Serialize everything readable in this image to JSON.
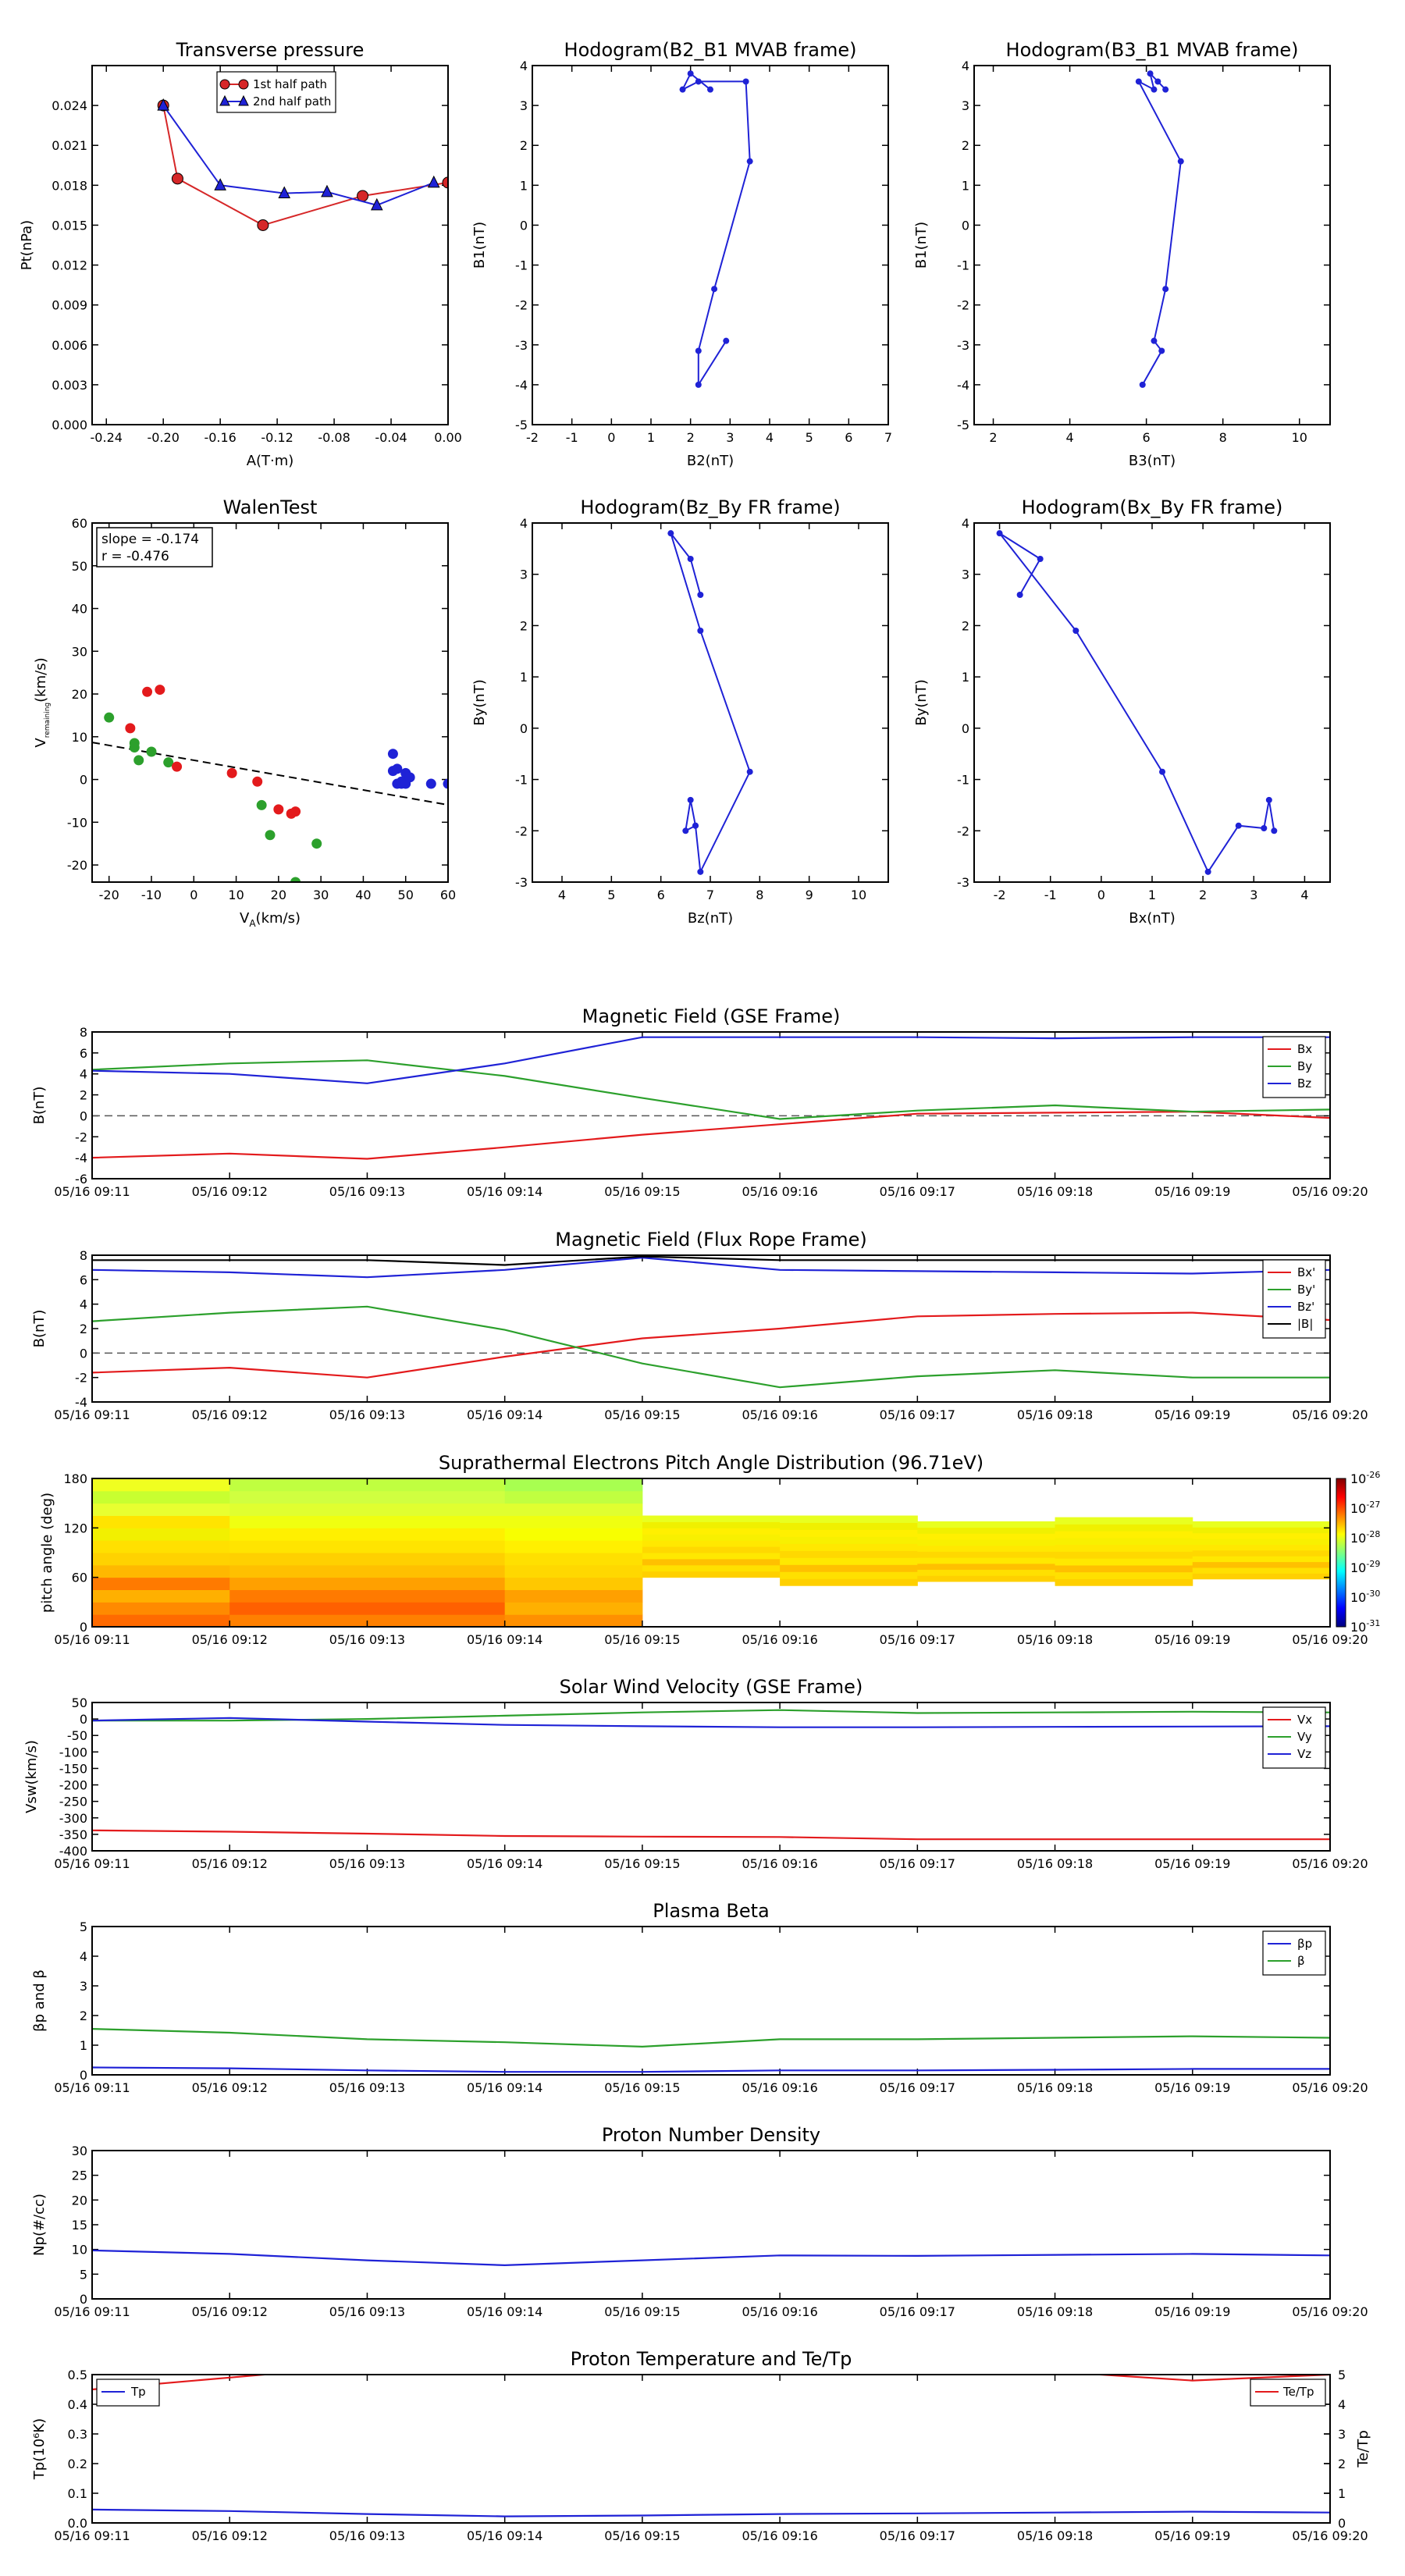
{
  "chart_data": [
    {
      "id": "transverse",
      "type": "line",
      "title": "Transverse pressure",
      "xlabel": "A(T·m)",
      "ylabel": "Pt(nPa)",
      "xlim": [
        -0.25,
        0.0
      ],
      "ylim": [
        0.0,
        0.027
      ],
      "xticks": [
        "-0.24",
        "-0.20",
        "-0.16",
        "-0.12",
        "-0.08",
        "-0.04",
        "0.00"
      ],
      "yticks": [
        "0.000",
        "0.003",
        "0.006",
        "0.009",
        "0.012",
        "0.015",
        "0.018",
        "0.021",
        "0.024"
      ],
      "series": [
        {
          "name": "1st half path",
          "color": "#d62728",
          "marker": "circle",
          "x": [
            -0.2,
            -0.19,
            -0.13,
            -0.06,
            0.0
          ],
          "y": [
            0.024,
            0.0185,
            0.015,
            0.0172,
            0.0182
          ]
        },
        {
          "name": "2nd half path",
          "color": "#1f22d6",
          "marker": "triangle",
          "x": [
            -0.2,
            -0.16,
            -0.115,
            -0.085,
            -0.05,
            -0.01
          ],
          "y": [
            0.024,
            0.018,
            0.0174,
            0.0175,
            0.0165,
            0.0182
          ]
        }
      ]
    },
    {
      "id": "hodo1",
      "type": "line",
      "title": "Hodogram(B2_B1 MVAB frame)",
      "xlabel": "B2(nT)",
      "ylabel": "B1(nT)",
      "xlim": [
        -2,
        7
      ],
      "ylim": [
        -5,
        4
      ],
      "xticks": [
        "-2",
        "-1",
        "0",
        "1",
        "2",
        "3",
        "4",
        "5",
        "6",
        "7"
      ],
      "yticks": [
        "-5",
        "-4",
        "-3",
        "-2",
        "-1",
        "0",
        "1",
        "2",
        "3",
        "4"
      ],
      "series": [
        {
          "color": "#1f22d6",
          "x": [
            2.5,
            2.0,
            1.8,
            2.2,
            3.4,
            3.5,
            2.6,
            2.2,
            2.2,
            2.9
          ],
          "y": [
            3.4,
            3.8,
            3.4,
            3.6,
            3.6,
            1.6,
            -1.6,
            -3.15,
            -4.0,
            -2.9
          ]
        }
      ]
    },
    {
      "id": "hodo2",
      "type": "line",
      "title": "Hodogram(B3_B1 MVAB frame)",
      "xlabel": "B3(nT)",
      "ylabel": "B1(nT)",
      "xlim": [
        1.5,
        10.8
      ],
      "ylim": [
        -5,
        4
      ],
      "xticks": [
        "2",
        "4",
        "6",
        "8",
        "10"
      ],
      "yticks": [
        "-5",
        "-4",
        "-3",
        "-2",
        "-1",
        "0",
        "1",
        "2",
        "3",
        "4"
      ],
      "series": [
        {
          "color": "#1f22d6",
          "x": [
            6.5,
            6.3,
            6.1,
            6.2,
            5.8,
            6.9,
            6.5,
            6.2,
            6.4,
            5.9
          ],
          "y": [
            3.4,
            3.6,
            3.8,
            3.4,
            3.6,
            1.6,
            -1.6,
            -2.9,
            -3.15,
            -4.0
          ]
        }
      ]
    },
    {
      "id": "walen",
      "type": "scatter",
      "title": "WalenTest",
      "xlabel": "V",
      "xlabel_sub": "A",
      "xlabel_rest": "(km/s)",
      "ylabel": "V",
      "ylabel_sub": "remaining",
      "ylabel_rest": "(km/s)",
      "xlim": [
        -24,
        60
      ],
      "ylim": [
        -24,
        60
      ],
      "xticks": [
        "-20",
        "-10",
        "0",
        "10",
        "20",
        "30",
        "40",
        "50",
        "60"
      ],
      "yticks": [
        "-20",
        "-10",
        "0",
        "10",
        "20",
        "30",
        "40",
        "50",
        "60"
      ],
      "annotation_slope": "slope = -0.174",
      "annotation_r": "r = -0.476",
      "fit": {
        "slope": -0.174,
        "intercept": 4.5
      },
      "series": [
        {
          "color": "#2ca02c",
          "x": [
            -20,
            -14,
            -14,
            -13,
            -10,
            -6,
            16,
            18,
            24,
            29
          ],
          "y": [
            14.5,
            8.5,
            7.5,
            4.5,
            6.5,
            4,
            -6,
            -13,
            -24,
            -15
          ]
        },
        {
          "color": "#e31a1c",
          "x": [
            -15,
            -11,
            -8,
            -4,
            9,
            15,
            20,
            23,
            24
          ],
          "y": [
            12,
            20.5,
            21,
            3,
            1.5,
            -0.5,
            -7,
            -8,
            -7.5
          ]
        },
        {
          "color": "#1f22d6",
          "x": [
            47,
            47,
            48,
            48,
            49,
            49,
            50,
            50,
            50,
            51,
            56,
            60
          ],
          "y": [
            6,
            2,
            2.5,
            -1,
            -1,
            -0.5,
            0,
            1.5,
            -1,
            0.5,
            -1,
            -1
          ]
        }
      ]
    },
    {
      "id": "hodo3",
      "type": "line",
      "title": "Hodogram(Bz_By FR frame)",
      "xlabel": "Bz(nT)",
      "ylabel": "By(nT)",
      "xlim": [
        3.4,
        10.6
      ],
      "ylim": [
        -3,
        4
      ],
      "xticks": [
        "4",
        "5",
        "6",
        "7",
        "8",
        "9",
        "10"
      ],
      "yticks": [
        "-3",
        "-2",
        "-1",
        "0",
        "1",
        "2",
        "3",
        "4"
      ],
      "series": [
        {
          "color": "#1f22d6",
          "x": [
            6.8,
            6.6,
            6.2,
            6.8,
            7.8,
            6.8,
            6.7,
            6.5,
            6.6,
            6.7
          ],
          "y": [
            2.6,
            3.3,
            3.8,
            1.9,
            -0.85,
            -2.8,
            -1.9,
            -2.0,
            -1.4,
            -1.9
          ]
        }
      ]
    },
    {
      "id": "hodo4",
      "type": "line",
      "title": "Hodogram(Bx_By FR frame)",
      "xlabel": "Bx(nT)",
      "ylabel": "By(nT)",
      "xlim": [
        -2.5,
        4.5
      ],
      "ylim": [
        -3,
        4
      ],
      "xticks": [
        "-2",
        "-1",
        "0",
        "1",
        "2",
        "3",
        "4"
      ],
      "yticks": [
        "-3",
        "-2",
        "-1",
        "0",
        "1",
        "2",
        "3",
        "4"
      ],
      "series": [
        {
          "color": "#1f22d6",
          "x": [
            -1.6,
            -1.2,
            -2.0,
            -0.5,
            1.2,
            2.1,
            2.7,
            3.2,
            3.3,
            3.4
          ],
          "y": [
            2.6,
            3.3,
            3.8,
            1.9,
            -0.85,
            -2.8,
            -1.9,
            -1.95,
            -1.4,
            -2.0
          ]
        }
      ]
    },
    {
      "id": "bgse",
      "type": "line",
      "title": "Magnetic Field (GSE Frame)",
      "ylabel": "B(nT)",
      "ylim": [
        -6,
        8
      ],
      "yticks": [
        "-6",
        "-4",
        "-2",
        "0",
        "2",
        "4",
        "6",
        "8"
      ],
      "xticks": [
        "05/16 09:11",
        "05/16 09:12",
        "05/16 09:13",
        "05/16 09:14",
        "05/16 09:15",
        "05/16 09:16",
        "05/16 09:17",
        "05/16 09:18",
        "05/16 09:19",
        "05/16 09:20"
      ],
      "zero_line": true,
      "series": [
        {
          "name": "Bx",
          "color": "#e31a1c",
          "values": [
            -4.0,
            -3.6,
            -4.1,
            -3.0,
            -1.8,
            -0.8,
            0.2,
            0.3,
            0.4,
            -0.2
          ]
        },
        {
          "name": "By",
          "color": "#2ca02c",
          "values": [
            4.4,
            5.0,
            5.3,
            3.8,
            1.7,
            -0.3,
            0.5,
            1.0,
            0.4,
            0.6
          ]
        },
        {
          "name": "Bz",
          "color": "#1f22d6",
          "values": [
            4.3,
            4.0,
            3.1,
            5.0,
            7.5,
            7.5,
            7.5,
            7.4,
            7.5,
            7.5
          ]
        }
      ]
    },
    {
      "id": "bfr",
      "type": "line",
      "title": "Magnetic Field (Flux Rope Frame)",
      "ylabel": "B(nT)",
      "ylim": [
        -4,
        8
      ],
      "yticks": [
        "-4",
        "-2",
        "0",
        "2",
        "4",
        "6",
        "8"
      ],
      "xticks": [
        "05/16 09:11",
        "05/16 09:12",
        "05/16 09:13",
        "05/16 09:14",
        "05/16 09:15",
        "05/16 09:16",
        "05/16 09:17",
        "05/16 09:18",
        "05/16 09:19",
        "05/16 09:20"
      ],
      "zero_line": true,
      "series": [
        {
          "name": "Bx'",
          "color": "#e31a1c",
          "values": [
            -1.6,
            -1.2,
            -2.0,
            -0.3,
            1.2,
            2.0,
            3.0,
            3.2,
            3.3,
            2.7
          ]
        },
        {
          "name": "By'",
          "color": "#2ca02c",
          "values": [
            2.6,
            3.3,
            3.8,
            1.9,
            -0.85,
            -2.8,
            -1.9,
            -1.4,
            -2.0,
            -2.0
          ]
        },
        {
          "name": "Bz'",
          "color": "#1f22d6",
          "values": [
            6.8,
            6.6,
            6.2,
            6.8,
            7.8,
            6.8,
            6.7,
            6.6,
            6.5,
            6.8
          ]
        },
        {
          "name": "|B|",
          "color": "#000000",
          "values": [
            7.6,
            7.6,
            7.6,
            7.2,
            7.9,
            7.6,
            7.6,
            7.6,
            7.6,
            7.6
          ]
        }
      ]
    },
    {
      "id": "pad",
      "type": "heatmap",
      "title": "Suprathermal Electrons Pitch Angle Distribution (96.71eV)",
      "ylabel": "pitch angle (deg)",
      "ylim": [
        0,
        180
      ],
      "yticks": [
        "0",
        "60",
        "120",
        "180"
      ],
      "xticks": [
        "05/16 09:11",
        "05/16 09:12",
        "05/16 09:13",
        "05/16 09:14",
        "05/16 09:15",
        "05/16 09:16",
        "05/16 09:17",
        "05/16 09:18",
        "05/16 09:19",
        "05/16 09:20"
      ],
      "colorbar": {
        "base": "10",
        "exponents": [
          "-26",
          "-27",
          "-28",
          "-29",
          "-30",
          "-31"
        ]
      },
      "columns": [
        {
          "range": [
            0,
            180
          ],
          "profile": "strong"
        },
        {
          "range": [
            0,
            180
          ],
          "profile": "strong2"
        },
        {
          "range": [
            0,
            180
          ],
          "profile": "strong2"
        },
        {
          "range": [
            0,
            180
          ],
          "profile": "medium"
        },
        {
          "range": [
            60,
            135
          ],
          "profile": "weak"
        },
        {
          "range": [
            50,
            135
          ],
          "profile": "weak"
        },
        {
          "range": [
            55,
            128
          ],
          "profile": "weak"
        },
        {
          "range": [
            50,
            133
          ],
          "profile": "weak"
        },
        {
          "range": [
            58,
            128
          ],
          "profile": "weak"
        }
      ]
    },
    {
      "id": "vsw",
      "type": "line",
      "title": "Solar Wind Velocity (GSE Frame)",
      "ylabel": "Vsw(km/s)",
      "ylim": [
        -400,
        50
      ],
      "yticks": [
        "-400",
        "-350",
        "-300",
        "-250",
        "-200",
        "-150",
        "-100",
        "-50",
        "0",
        "50"
      ],
      "xticks": [
        "05/16 09:11",
        "05/16 09:12",
        "05/16 09:13",
        "05/16 09:14",
        "05/16 09:15",
        "05/16 09:16",
        "05/16 09:17",
        "05/16 09:18",
        "05/16 09:19",
        "05/16 09:20"
      ],
      "series": [
        {
          "name": "Vx",
          "color": "#e31a1c",
          "values": [
            -338,
            -342,
            -348,
            -355,
            -357,
            -358,
            -365,
            -365,
            -365,
            -365
          ]
        },
        {
          "name": "Vy",
          "color": "#2ca02c",
          "values": [
            -5,
            -5,
            0,
            10,
            20,
            27,
            18,
            20,
            22,
            20
          ]
        },
        {
          "name": "Vz",
          "color": "#1f22d6",
          "values": [
            -5,
            3,
            -8,
            -18,
            -22,
            -25,
            -25,
            -24,
            -23,
            -22
          ]
        }
      ]
    },
    {
      "id": "beta",
      "type": "line",
      "title": "Plasma Beta",
      "ylabel": "βp and β",
      "ylim": [
        0,
        5
      ],
      "yticks": [
        "0",
        "1",
        "2",
        "3",
        "4",
        "5"
      ],
      "xticks": [
        "05/16 09:11",
        "05/16 09:12",
        "05/16 09:13",
        "05/16 09:14",
        "05/16 09:15",
        "05/16 09:16",
        "05/16 09:17",
        "05/16 09:18",
        "05/16 09:19",
        "05/16 09:20"
      ],
      "series": [
        {
          "name": "βp",
          "color": "#1f22d6",
          "values": [
            0.25,
            0.22,
            0.15,
            0.1,
            0.1,
            0.15,
            0.15,
            0.17,
            0.2,
            0.2
          ]
        },
        {
          "name": "β",
          "color": "#2ca02c",
          "values": [
            1.55,
            1.42,
            1.2,
            1.1,
            0.95,
            1.2,
            1.2,
            1.25,
            1.3,
            1.25
          ]
        }
      ]
    },
    {
      "id": "np",
      "type": "line",
      "title": "Proton Number Density",
      "ylabel": "Np(#/cc)",
      "ylim": [
        0,
        30
      ],
      "yticks": [
        "0",
        "5",
        "10",
        "15",
        "20",
        "25",
        "30"
      ],
      "xticks": [
        "05/16 09:11",
        "05/16 09:12",
        "05/16 09:13",
        "05/16 09:14",
        "05/16 09:15",
        "05/16 09:16",
        "05/16 09:17",
        "05/16 09:18",
        "05/16 09:19",
        "05/16 09:20"
      ],
      "series": [
        {
          "color": "#1f22d6",
          "values": [
            9.8,
            9.1,
            7.8,
            6.8,
            7.8,
            8.8,
            8.7,
            8.9,
            9.1,
            8.8
          ]
        }
      ]
    },
    {
      "id": "tp",
      "type": "line",
      "title": "Proton Temperature and Te/Tp",
      "ylabel": "Tp(10⁶K)",
      "ylabel2": "Te/Tp",
      "ylim": [
        0,
        0.5
      ],
      "ylim2": [
        0,
        5
      ],
      "yticks": [
        "0.0",
        "0.1",
        "0.2",
        "0.3",
        "0.4",
        "0.5"
      ],
      "yticks2": [
        "0",
        "1",
        "2",
        "3",
        "4",
        "5"
      ],
      "xticks": [
        "05/16 09:11",
        "05/16 09:12",
        "05/16 09:13",
        "05/16 09:14",
        "05/16 09:15",
        "05/16 09:16",
        "05/16 09:17",
        "05/16 09:18",
        "05/16 09:19",
        "05/16 09:20"
      ],
      "series": [
        {
          "name": "Tp",
          "color": "#1f22d6",
          "axis": "left",
          "values": [
            0.045,
            0.04,
            0.03,
            0.022,
            0.025,
            0.03,
            0.032,
            0.035,
            0.038,
            0.035
          ]
        },
        {
          "name": "Te/Tp",
          "color": "#e31a1c",
          "axis": "right",
          "values": [
            4.5,
            4.9,
            5.3,
            5.6,
            5.6,
            5.4,
            5.3,
            5.1,
            4.8,
            5.0
          ]
        }
      ]
    }
  ]
}
